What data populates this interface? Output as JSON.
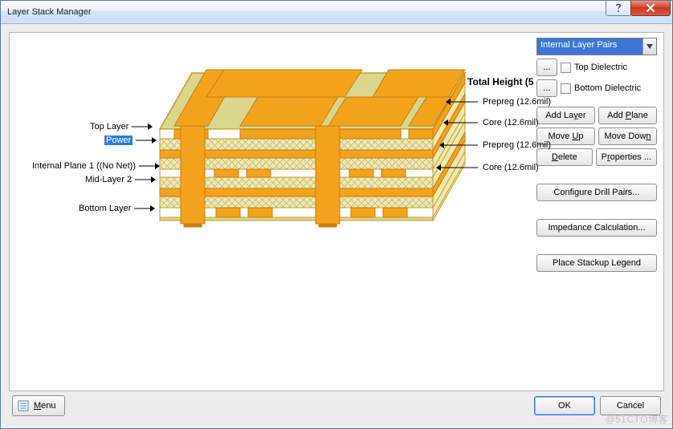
{
  "window": {
    "title": "Layer Stack Manager"
  },
  "combo": {
    "selected": "Internal Layer Pairs"
  },
  "dielectric": {
    "top_ellipsis": "...",
    "top_label": "Top Dielectric",
    "bottom_ellipsis": "...",
    "bottom_label": "Bottom Dielectric"
  },
  "buttons": {
    "add_layer": "Add Layer",
    "add_plane": "Add Plane",
    "move_up": "Move Up",
    "move_down": "Move Down",
    "delete": "Delete",
    "properties": "Properties ...",
    "configure_drill": "Configure Drill Pairs...",
    "impedance": "Impedance Calculation...",
    "place_legend": "Place Stackup Legend"
  },
  "diagram": {
    "total_height_label": "Total Height (5",
    "left_labels": [
      "Top Layer",
      "Power",
      "Internal Plane 1 ((No Net))",
      "Mid-Layer 2",
      "Bottom Layer"
    ],
    "callouts": [
      "Prepreg (12.6mil)",
      "Core (12.6mil)",
      "Prepreg (12.6mil)",
      "Core (12.6mil)"
    ]
  },
  "footer": {
    "menu": "Menu",
    "ok": "OK",
    "cancel": "Cancel"
  },
  "watermark": "@51CTO博客"
}
